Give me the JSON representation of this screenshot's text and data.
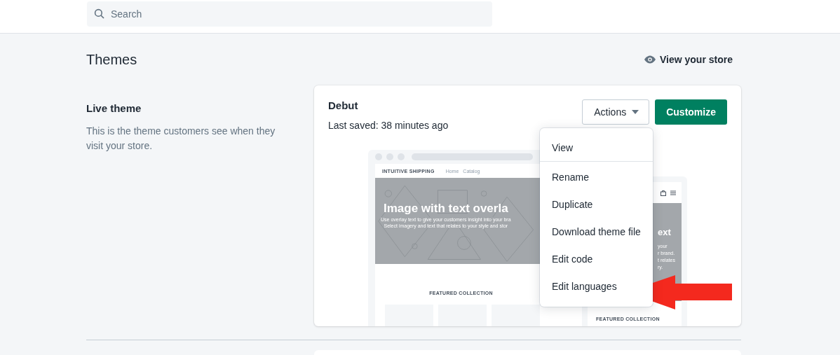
{
  "search": {
    "placeholder": "Search"
  },
  "page": {
    "title": "Themes",
    "view_store": "View your store"
  },
  "live_theme": {
    "heading": "Live theme",
    "description": "This is the theme customers see when they visit your store."
  },
  "theme_card": {
    "name": "Debut",
    "last_saved": "Last saved: 38 minutes ago",
    "actions_button": "Actions",
    "customize_button": "Customize",
    "actions_menu": {
      "expanded": true,
      "sections": [
        {
          "items": [
            "View"
          ]
        },
        {
          "items": [
            "Rename",
            "Duplicate",
            "Download theme file",
            "Edit code",
            "Edit languages"
          ]
        }
      ]
    },
    "preview": {
      "desktop": {
        "store_name": "INTUITIVE SHIPPING",
        "nav": [
          "Home",
          "Catalog"
        ],
        "hero_title": "Image with text overla",
        "hero_lines": [
          "Use overlay text to give your customers insight into your bra",
          "Select imagery and text that relates to your style and stor"
        ],
        "section_title": "FEATURED COLLECTION"
      },
      "mobile": {
        "hero_title": "ext",
        "hero_lines": [
          "your",
          "r brand.",
          "t relates",
          "ry."
        ],
        "section_title": "FEATURED COLLECTION"
      }
    }
  }
}
